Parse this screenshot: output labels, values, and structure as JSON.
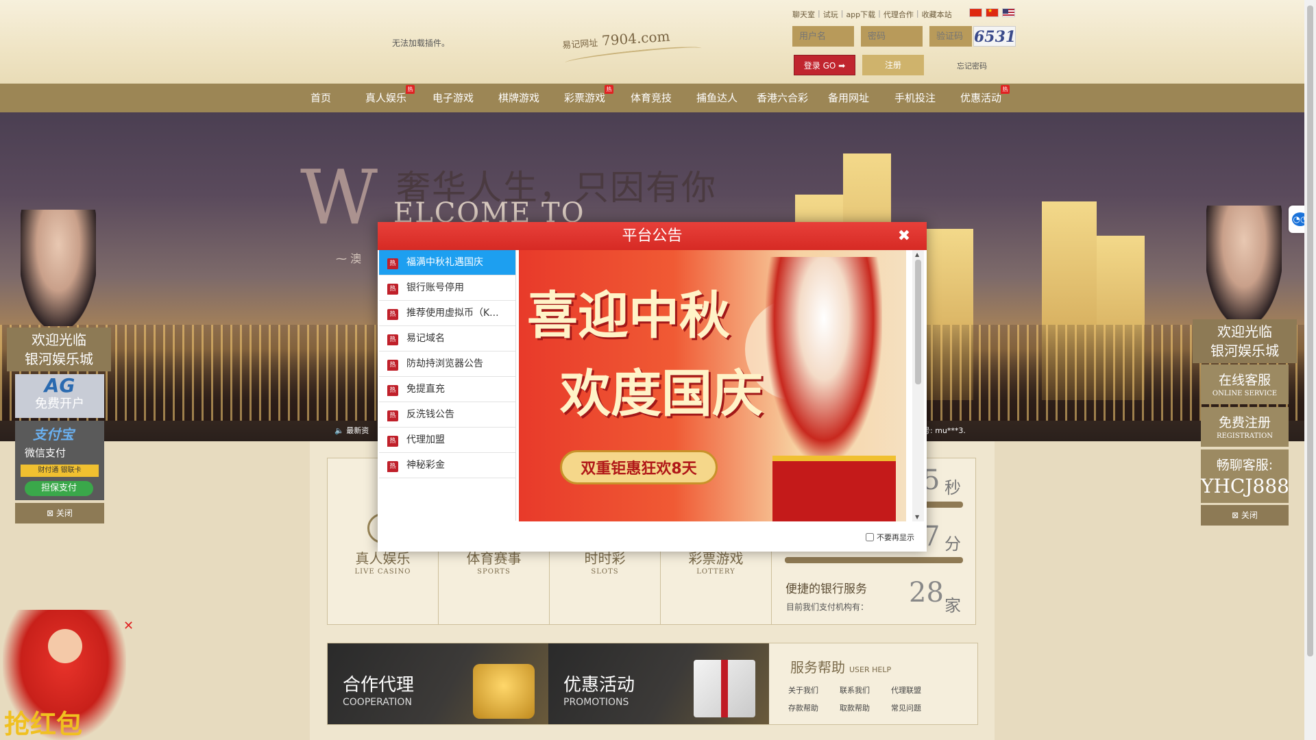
{
  "header": {
    "plugin_message": "无法加载插件。",
    "logo_prefix": "易记网址",
    "logo_domain": "7904.com",
    "top_links": [
      "聊天室",
      "试玩",
      "app下载",
      "代理合作",
      "收藏本站"
    ],
    "username_placeholder": "用户名",
    "password_placeholder": "密码",
    "captcha_placeholder": "验证码",
    "captcha_code": "6531",
    "login_label": "登录 GO ➡",
    "register_label": "注册",
    "forgot_label": "忘记密码"
  },
  "nav": {
    "items": [
      {
        "label": "首页",
        "hot": false
      },
      {
        "label": "真人娱乐",
        "hot": true
      },
      {
        "label": "电子游戏",
        "hot": false
      },
      {
        "label": "棋牌游戏",
        "hot": false
      },
      {
        "label": "彩票游戏",
        "hot": true
      },
      {
        "label": "体育竞技",
        "hot": false
      },
      {
        "label": "捕鱼达人",
        "hot": false
      },
      {
        "label": "香港六合彩",
        "hot": false
      },
      {
        "label": "备用网址",
        "hot": false
      },
      {
        "label": "手机投注",
        "hot": false
      },
      {
        "label": "优惠活动",
        "hot": true
      }
    ],
    "hot_label": "热"
  },
  "banner": {
    "w_letter": "W",
    "slogan": "奢华人生，只因有你",
    "welcome": "ELCOME TO",
    "sub_text": "澳",
    "ticker_left": "🔈 最新资",
    "ticker_right": "号: mu***3."
  },
  "categories": [
    {
      "zh": "真人娱乐",
      "en": "LIVE CASINO"
    },
    {
      "zh": "体育赛事",
      "en": "SPORTS"
    },
    {
      "zh": "时时彩",
      "en": "SLOTS"
    },
    {
      "zh": "彩票游戏",
      "en": "LOTTERY"
    }
  ],
  "stats": {
    "deposit_num": "5",
    "deposit_unit": "秒",
    "withdraw_num": "7",
    "withdraw_unit": "分",
    "bank_title": "便捷的银行服务",
    "bank_sub": "目前我们支付机构有：",
    "bank_num": "28",
    "bank_unit": "家"
  },
  "promos": [
    {
      "zh": "合作代理",
      "en": "COOPERATION"
    },
    {
      "zh": "优惠活动",
      "en": "PROMOTIONS"
    }
  ],
  "help": {
    "title": "服务帮助",
    "title_en": "USER HELP",
    "links": [
      "关于我们",
      "联系我们",
      "代理联盟",
      "存款帮助",
      "取款帮助",
      "常见问题"
    ]
  },
  "left_float": {
    "welcome": "欢迎光临",
    "welcome2": "银河娱乐城",
    "ag_logo": "AG",
    "ag_text": "免费开户",
    "pay1": "支付宝",
    "pay2": "微信支付",
    "pay3": "财付通 银联卡",
    "pay4": "担保支付",
    "close": "⊠ 关闭"
  },
  "right_float": {
    "welcome": "欢迎光临",
    "welcome2": "银河娱乐城",
    "service_zh": "在线客服",
    "service_en": "ONLINE SERVICE",
    "register_zh": "免费注册",
    "register_en": "REGISTRATION",
    "chat_zh": "畅聊客服:",
    "chat_id": "YHCJ888",
    "close": "⊠ 关闭"
  },
  "caishen": {
    "text": "抢红包",
    "close": "✕"
  },
  "modal": {
    "title": "平台公告",
    "close": "✖",
    "notices": [
      "福满中秋礼遇国庆",
      "银行账号停用",
      "推荐使用虚拟币（K...",
      "易记域名",
      "防劫持浏览器公告",
      "免提直充",
      "反洗钱公告",
      "代理加盟",
      "神秘彩金"
    ],
    "active_index": 0,
    "image_line1": "喜迎中秋",
    "image_line2": "欢度国庆",
    "image_ribbon": "双重钜惠狂欢8天",
    "dont_show": "不要再显示"
  },
  "colors": {
    "nav": "#9c8655",
    "modal_header": "#d62a24",
    "active_notice": "#1d9ff0",
    "hot_badge": "#e02323"
  }
}
